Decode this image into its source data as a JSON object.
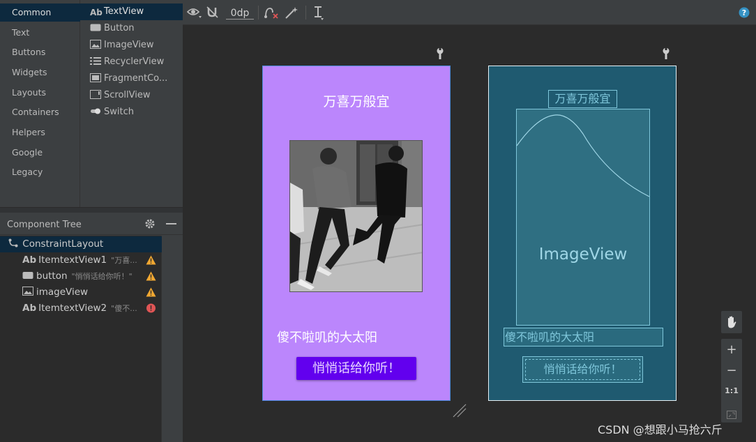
{
  "palette": {
    "categories": [
      "Common",
      "Text",
      "Buttons",
      "Widgets",
      "Layouts",
      "Containers",
      "Helpers",
      "Google",
      "Legacy"
    ],
    "selected_category": "Common",
    "items": [
      {
        "label": "TextView",
        "icon": "textview-ab-icon"
      },
      {
        "label": "Button",
        "icon": "button-icon"
      },
      {
        "label": "ImageView",
        "icon": "image-icon"
      },
      {
        "label": "RecyclerView",
        "icon": "list-icon"
      },
      {
        "label": "FragmentCo...",
        "icon": "fragment-icon"
      },
      {
        "label": "ScrollView",
        "icon": "scrollview-icon"
      },
      {
        "label": "Switch",
        "icon": "switch-icon"
      }
    ],
    "textview_ab": "Ab"
  },
  "component_tree": {
    "title": "Component Tree",
    "root": "ConstraintLayout",
    "nodes": [
      {
        "name": "ItemtextView1",
        "preview": "\"万喜...",
        "icon_text": "Ab",
        "status": "warning"
      },
      {
        "name": "button",
        "preview": "\"悄悄话给你听！\"",
        "icon_text": "",
        "status": "warning"
      },
      {
        "name": "imageView",
        "preview": "",
        "icon_text": "",
        "status": "warning"
      },
      {
        "name": "ItemtextView2",
        "preview": "\"傻不...",
        "icon_text": "Ab",
        "status": "error"
      }
    ]
  },
  "toolbar": {
    "margin_value": "0dp"
  },
  "design": {
    "title": "万喜万般宜",
    "subtitle": "傻不啦叽的大太阳",
    "button": "悄悄话给你听！"
  },
  "blueprint": {
    "title": "万喜万般宜",
    "image_label": "ImageView",
    "subtitle": "傻不啦叽的大太阳",
    "button": "悄悄话给你听！"
  },
  "zoom": {
    "plus": "+",
    "minus": "−",
    "one_to_one": "1:1"
  },
  "watermark": "CSDN @想跟小马抢六斤",
  "colors": {
    "design_bg": "#bb86fc",
    "button_bg": "#6200ee",
    "blueprint_bg": "#1f5a70",
    "warning": "#f0a732",
    "error": "#e05555"
  }
}
